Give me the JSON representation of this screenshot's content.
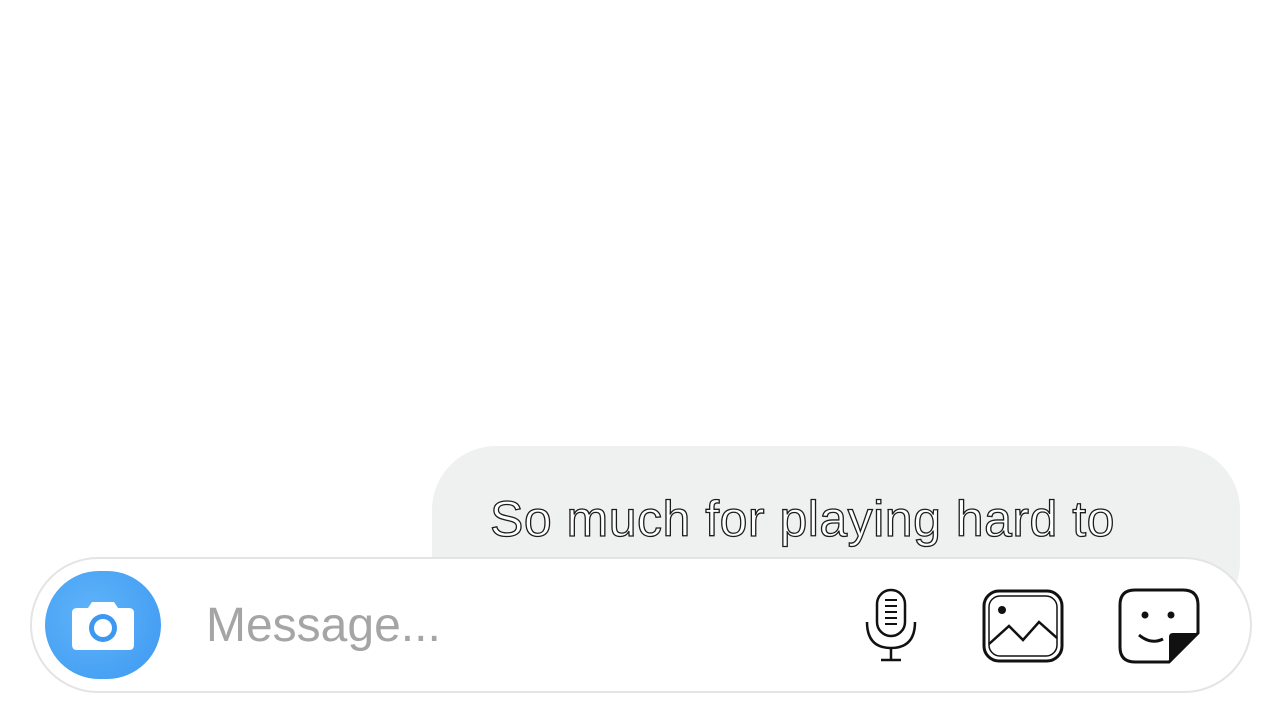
{
  "conversation": {
    "messages": [
      {
        "text": "So much for playing hard to"
      }
    ]
  },
  "composer": {
    "placeholder": "Message...",
    "value": ""
  },
  "icons": {
    "camera": "camera-icon",
    "microphone": "microphone-icon",
    "gallery": "gallery-icon",
    "sticker": "sticker-icon"
  },
  "colors": {
    "background": "#ffffff",
    "bubble": "#eff0f0",
    "camera_button": "#3d98f1",
    "placeholder": "#a5a5a5",
    "composer_border": "#e4e4e4"
  }
}
